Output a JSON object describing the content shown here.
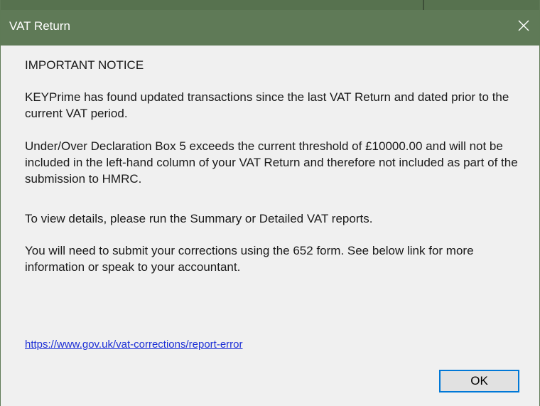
{
  "window": {
    "title": "VAT Return",
    "title_bar_color": "#5f7a57",
    "close_icon": "close-icon"
  },
  "message": {
    "heading": "IMPORTANT NOTICE",
    "paragraph1": "KEYPrime has found updated transactions since the last VAT Return and dated prior to the current VAT period.",
    "paragraph2": "Under/Over Declaration Box 5 exceeds the current threshold of £10000.00 and will not be included in the left-hand column of your VAT Return and therefore not included as part of the submission to HMRC.",
    "paragraph3": "To view details, please run the Summary or Detailed VAT reports.",
    "paragraph4": "You will need to submit your corrections using the 652 form. See below link for more information or speak to your accountant."
  },
  "link": {
    "text": "https://www.gov.uk/vat-corrections/report-error",
    "color": "#1c2fd6"
  },
  "buttons": {
    "ok_label": "OK",
    "focus_color": "#0078d7"
  }
}
